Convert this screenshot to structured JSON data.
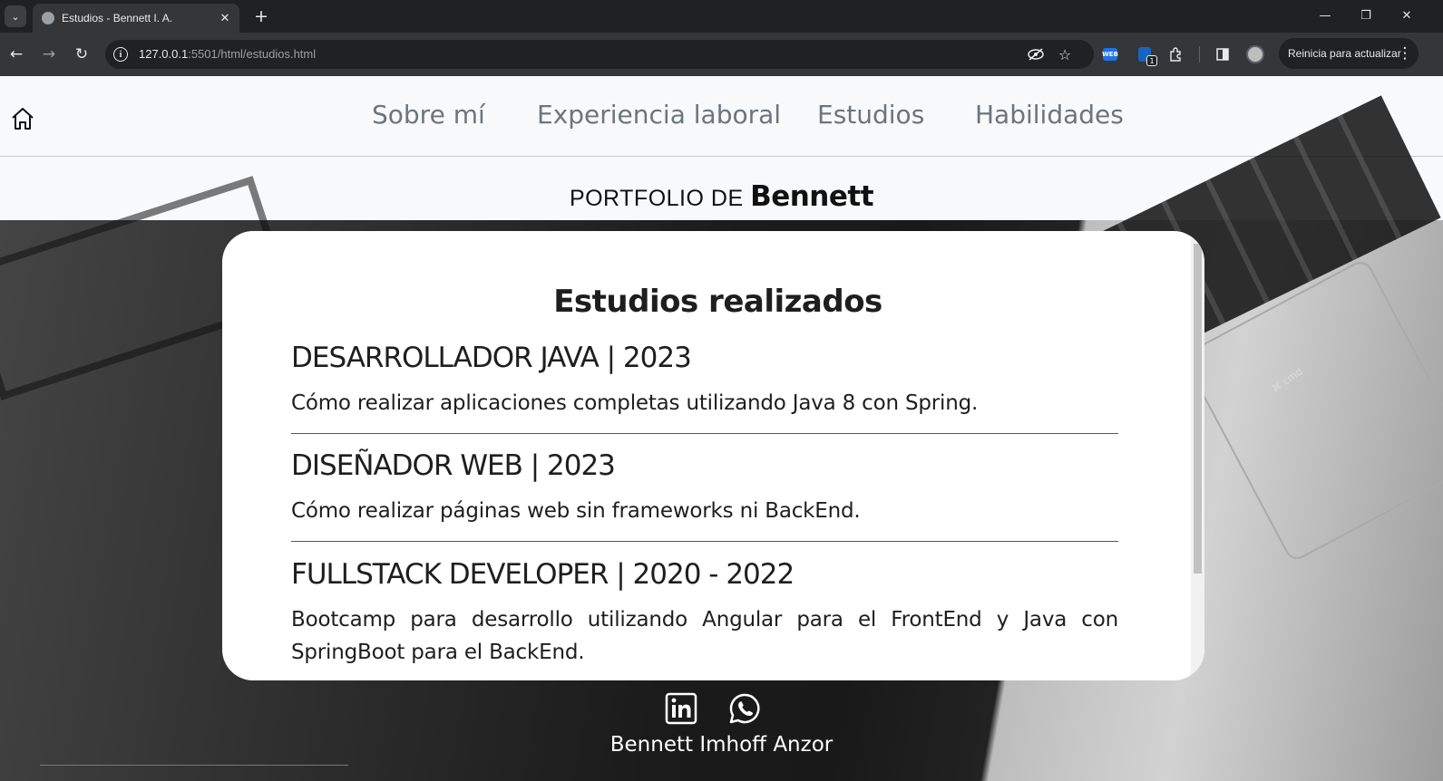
{
  "browser": {
    "tab_title": "Estudios - Bennett I. A.",
    "url_host": "127.0.0.1",
    "url_rest": ":5501/html/estudios.html",
    "update_button": "Reinicia para actualizar",
    "extension_badge": "1",
    "extension_label": "WEB",
    "icons": [
      "tab-search-icon",
      "globe-icon",
      "close-icon",
      "plus-icon",
      "minimize-icon",
      "restore-icon",
      "window-close-icon",
      "back-icon",
      "forward-icon",
      "reload-icon",
      "site-info-icon",
      "eye-off-icon",
      "star-icon",
      "extensions-icon",
      "side-panel-icon",
      "avatar",
      "more-icon"
    ]
  },
  "nav": {
    "links": [
      "Sobre mí",
      "Experiencia laboral",
      "Estudios",
      "Habilidades"
    ]
  },
  "brand": {
    "prefix": "PORTFOLIO DE ",
    "name": "Bennett"
  },
  "hero": {
    "cmd_key": "⌘ cmd"
  },
  "studies": {
    "title": "Estudios realizados",
    "items": [
      {
        "heading": "DESARROLLADOR JAVA | 2023",
        "description": "Cómo realizar aplicaciones completas utilizando Java 8 con Spring."
      },
      {
        "heading": "DISEÑADOR WEB | 2023",
        "description": "Cómo realizar páginas web sin frameworks ni BackEnd."
      },
      {
        "heading": "FULLSTACK DEVELOPER | 2020 - 2022",
        "description": "Bootcamp para desarrollo utilizando Angular para el FrontEnd y Java con SpringBoot para el BackEnd."
      }
    ]
  },
  "footer": {
    "name": "Bennett Imhoff Anzor"
  },
  "colors": {
    "nav_bg": "#f8f9fa",
    "nav_link": "#6c757d",
    "card_bg": "#ffffff",
    "text": "#1e1e1e"
  }
}
